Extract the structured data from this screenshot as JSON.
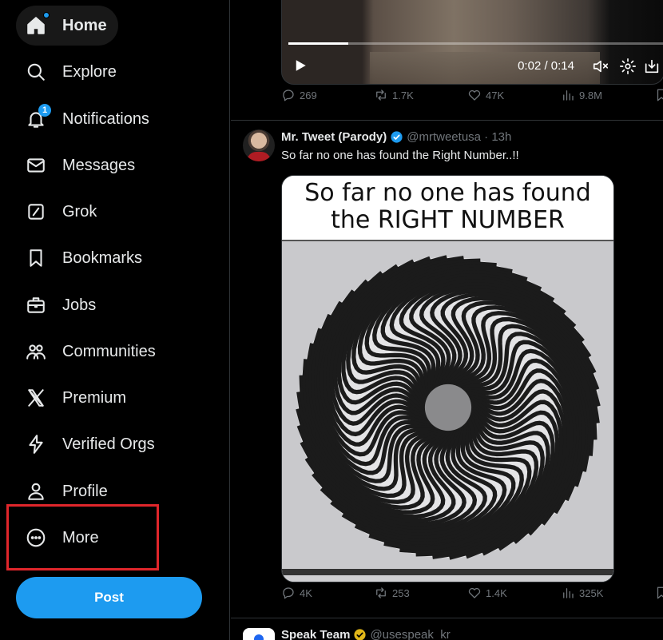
{
  "nav": {
    "items": [
      {
        "label": "Home",
        "icon": "home-icon"
      },
      {
        "label": "Explore",
        "icon": "search-icon"
      },
      {
        "label": "Notifications",
        "icon": "bell-icon",
        "badge": "1"
      },
      {
        "label": "Messages",
        "icon": "envelope-icon"
      },
      {
        "label": "Grok",
        "icon": "grok-icon"
      },
      {
        "label": "Bookmarks",
        "icon": "bookmark-icon"
      },
      {
        "label": "Jobs",
        "icon": "briefcase-icon"
      },
      {
        "label": "Communities",
        "icon": "people-icon"
      },
      {
        "label": "Premium",
        "icon": "x-logo-icon"
      },
      {
        "label": "Verified Orgs",
        "icon": "lightning-icon"
      },
      {
        "label": "Profile",
        "icon": "person-icon"
      },
      {
        "label": "More",
        "icon": "more-circle-icon"
      }
    ],
    "post_label": "Post"
  },
  "video": {
    "time": "0:02 / 0:14",
    "progress": 0.16,
    "stats": {
      "replies": "269",
      "reposts": "1.7K",
      "likes": "47K",
      "views": "9.8M"
    }
  },
  "tweet": {
    "name": "Mr. Tweet (Parody)",
    "handle": "@mrtweetusa · 13h",
    "text": "So far no one has found the Right Number..!!",
    "image_caption_line1": "So far no one has found",
    "image_caption_line2": "the RIGHT NUMBER",
    "stats": {
      "replies": "4K",
      "reposts": "253",
      "likes": "1.4K",
      "views": "325K"
    }
  },
  "next_tweet": {
    "name": "Speak Team",
    "handle": "@usespeak_kr"
  },
  "colors": {
    "accent": "#1d9bf0",
    "highlight": "#e0262b",
    "muted": "#71767b",
    "gold": "#e2b719"
  }
}
